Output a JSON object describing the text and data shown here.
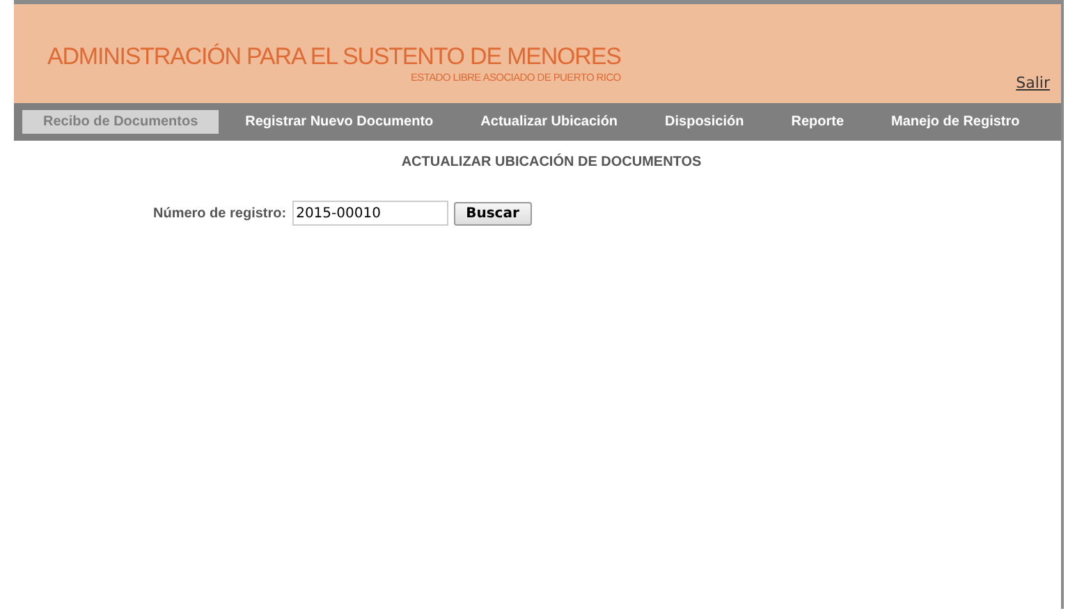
{
  "header": {
    "title": "ADMINISTRACIÓN PARA EL SUSTENTO DE MENORES",
    "subtitle": "ESTADO LIBRE ASOCIADO DE PUERTO RICO",
    "logout_link": "Salir"
  },
  "nav": [
    {
      "label": "Recibo de Documentos",
      "selected": true
    },
    {
      "label": "Registrar Nuevo Documento",
      "selected": false
    },
    {
      "label": "Actualizar Ubicación",
      "selected": false
    },
    {
      "label": "Disposición",
      "selected": false
    },
    {
      "label": "Reporte",
      "selected": false
    },
    {
      "label": "Manejo de Registro",
      "selected": false
    }
  ],
  "page_title": "ACTUALIZAR UBICACIÓN DE DOCUMENTOS",
  "search": {
    "label": "Número de registro:",
    "value": "2015-00010",
    "button": "Buscar"
  }
}
